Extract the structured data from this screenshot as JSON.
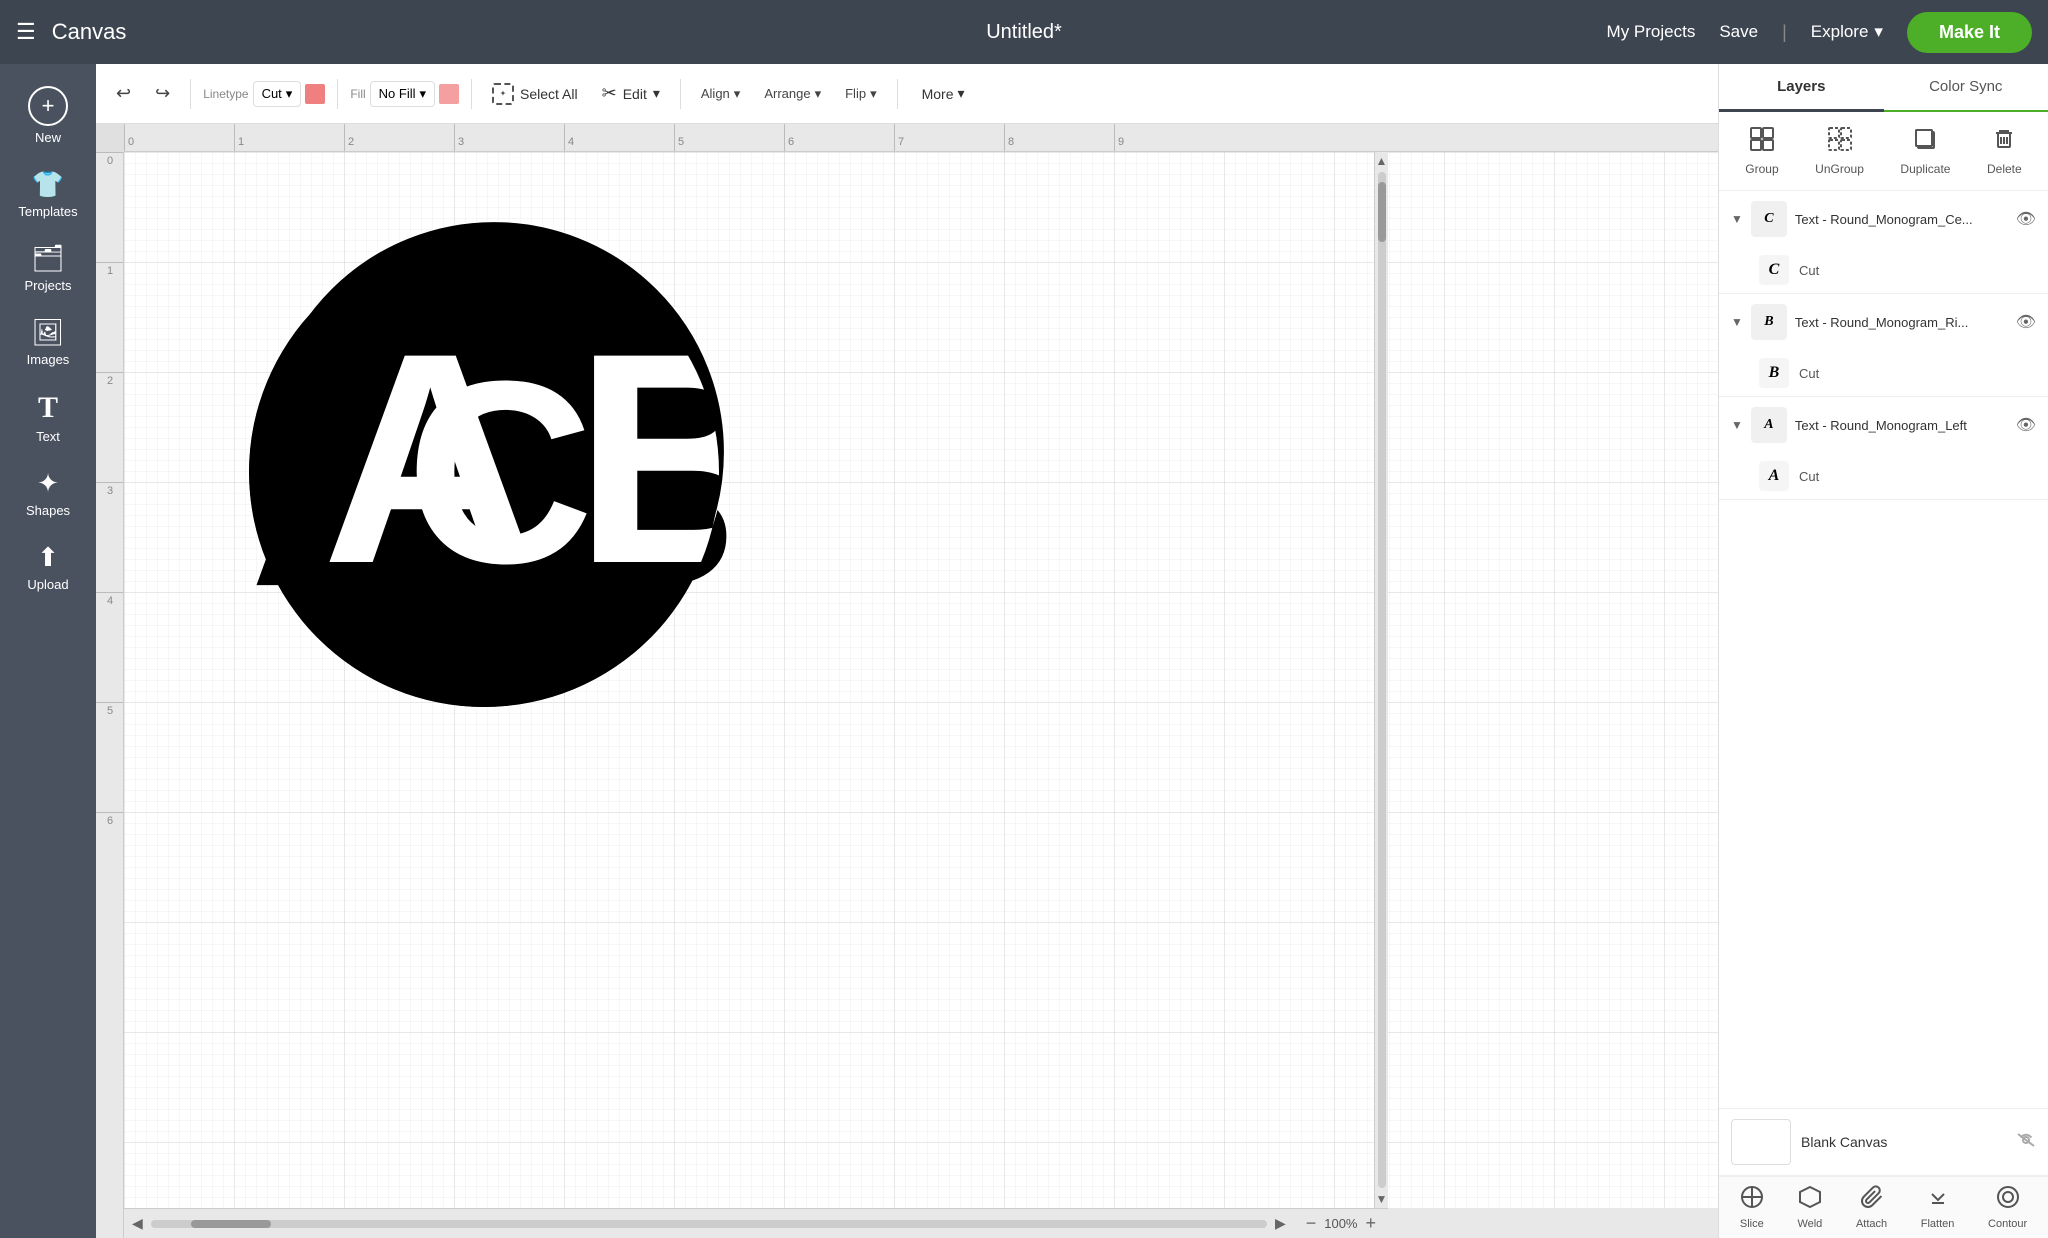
{
  "app": {
    "title": "Canvas",
    "project_title": "Untitled*"
  },
  "nav": {
    "my_projects": "My Projects",
    "save": "Save",
    "explore": "Explore",
    "make_it": "Make It"
  },
  "toolbar": {
    "linetype_label": "Linetype",
    "linetype_value": "Cut",
    "fill_label": "Fill",
    "fill_value": "No Fill",
    "select_all": "Select All",
    "edit": "Edit",
    "align": "Align",
    "arrange": "Arrange",
    "flip": "Flip",
    "more": "More"
  },
  "sidebar": {
    "items": [
      {
        "label": "New",
        "icon": "➕"
      },
      {
        "label": "Templates",
        "icon": "👕"
      },
      {
        "label": "Projects",
        "icon": "🗂"
      },
      {
        "label": "Images",
        "icon": "🖼"
      },
      {
        "label": "Text",
        "icon": "T"
      },
      {
        "label": "Shapes",
        "icon": "✦"
      },
      {
        "label": "Upload",
        "icon": "⬆"
      }
    ]
  },
  "rulers": {
    "h_ticks": [
      "0",
      "1",
      "2",
      "3",
      "4",
      "5",
      "6",
      "7",
      "8",
      "9"
    ],
    "v_ticks": [
      "0",
      "1",
      "2",
      "3",
      "4",
      "5",
      "6"
    ]
  },
  "zoom": {
    "level": "100%"
  },
  "right_panel": {
    "tabs": [
      {
        "label": "Layers",
        "active": true
      },
      {
        "label": "Color Sync",
        "active": false
      }
    ],
    "actions": [
      {
        "label": "Group",
        "icon": "⊞",
        "disabled": false
      },
      {
        "label": "UnGroup",
        "icon": "⊟",
        "disabled": false
      },
      {
        "label": "Duplicate",
        "icon": "⧉",
        "disabled": false
      },
      {
        "label": "Delete",
        "icon": "🗑",
        "disabled": false
      }
    ],
    "layers": [
      {
        "title": "Text - Round_Monogram_Ce...",
        "eye_visible": true,
        "sub_label": "Cut",
        "sub_char": "C"
      },
      {
        "title": "Text - Round_Monogram_Ri...",
        "eye_visible": true,
        "sub_label": "Cut",
        "sub_char": "B"
      },
      {
        "title": "Text - Round_Monogram_Left",
        "eye_visible": true,
        "sub_label": "Cut",
        "sub_char": "A"
      }
    ],
    "blank_canvas": {
      "label": "Blank Canvas",
      "eye_hidden": true
    },
    "bottom_tools": [
      {
        "label": "Slice",
        "icon": "⊗"
      },
      {
        "label": "Weld",
        "icon": "⬡"
      },
      {
        "label": "Attach",
        "icon": "📎"
      },
      {
        "label": "Flatten",
        "icon": "⬇"
      },
      {
        "label": "Contour",
        "icon": "◎"
      }
    ]
  }
}
